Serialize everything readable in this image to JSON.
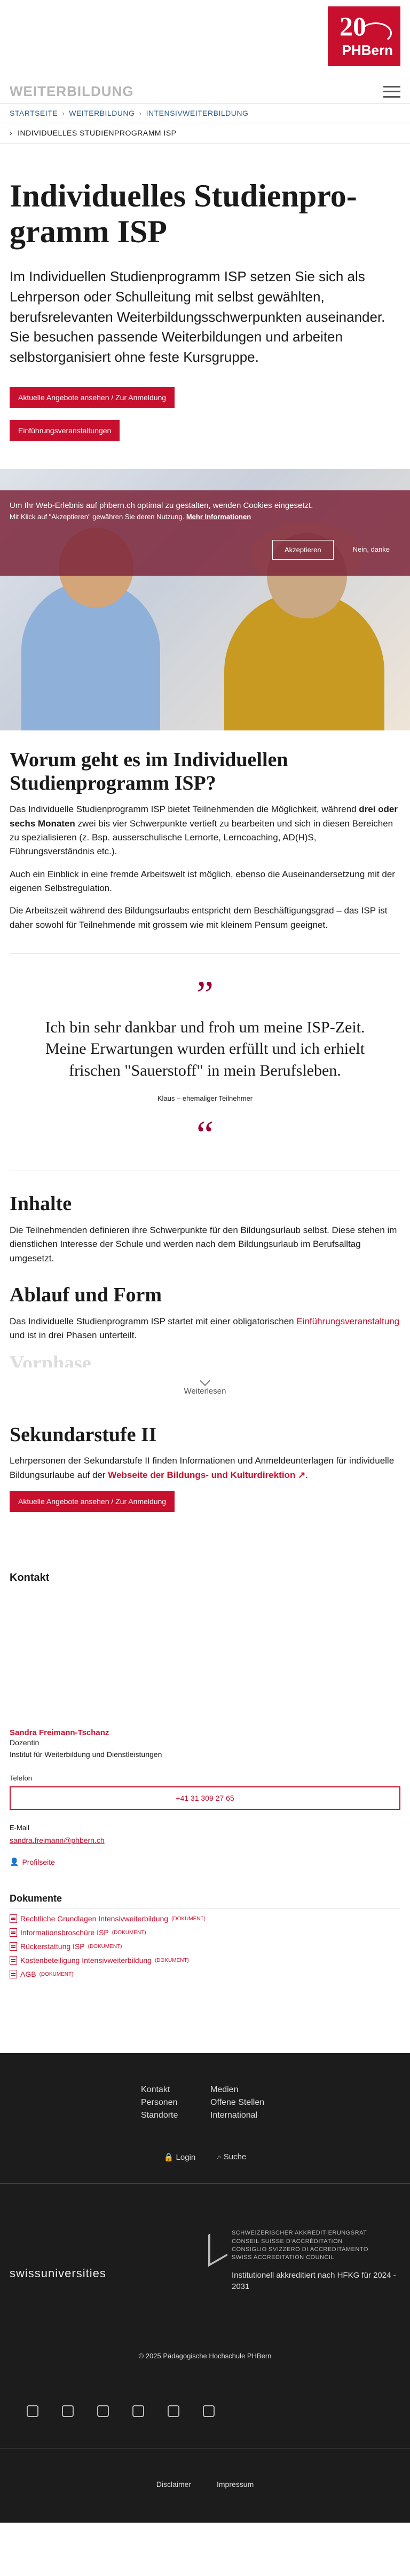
{
  "logo": {
    "number": "20",
    "text": "PHBern"
  },
  "subnav": {
    "title": "WEITERBILDUNG"
  },
  "breadcrumb": [
    "STARTSEITE",
    "WEITERBILDUNG",
    "INTENSIVWEITERBILDUNG"
  ],
  "current_page": "INDIVIDUELLES STUDIENPROGRAMM ISP",
  "title": "Individuelles Studienpro- gramm ISP",
  "lead": "Im Individuellen Studienprogramm ISP setzen Sie sich als Lehrperson oder Schulleitung mit selbst gewählten, berufsrelevanten Weiterbildungsschwerpunkten auseinander. Sie besuchen passende Weiterbildungen und arbeiten selbstorganisiert ohne feste Kursgruppe.",
  "buttons": {
    "offers": "Aktuelle Angebote ansehen / Zur Anmeldung",
    "events": "Einführungsveranstaltungen"
  },
  "cookie": {
    "text": "Um Ihr Web-Erlebnis auf phbern.ch optimal zu gestalten, wenden Cookies eingesetzt.",
    "small": "Mit Klick auf \"Akzeptieren\" gewähren Sie deren Nutzung.",
    "link": "Mehr Informationen",
    "accept": "Akzeptieren",
    "decline": "Nein, danke"
  },
  "section1": {
    "title": "Worum geht es im Individuellen Studienprogramm ISP?",
    "p1a": "Das Individuelle Studienprogramm ISP bietet Teilnehmenden die Möglichkeit, während ",
    "p1b": "drei oder sechs Monaten",
    "p1c": " zwei bis vier Schwerpunkte vertieft zu bearbeiten und sich in diesen Bereichen zu spezialisieren (z. Bsp. ausserschulische Lernorte, Lerncoaching, AD(H)S, Führungsverständnis etc.).",
    "p2": "Auch ein Einblick in eine fremde Arbeitswelt ist möglich, ebenso die Auseinandersetzung mit der eigenen Selbstregulation.",
    "p3": "Die Arbeitszeit während des Bildungsurlaubs entspricht dem Beschäftigungsgrad – das ISP ist daher sowohl für Teilnehmende mit grossem wie mit kleinem Pensum geeignet."
  },
  "quote": {
    "text": "Ich bin sehr dankbar und froh um meine ISP-Zeit. Meine Erwartungen wurden erfüllt und ich erhielt frischen \"Sauerstoff\" in mein Berufsleben.",
    "author": "Klaus – ehemaliger Teilnehmer"
  },
  "inhalte": {
    "title": "Inhalte",
    "text": "Die Teilnehmenden definieren ihre Schwerpunkte für den Bildungsurlaub selbst. Diese stehen im dienstlichen Interesse der Schule und werden nach dem Bildungsurlaub im Berufsalltag umgesetzt."
  },
  "ablauf": {
    "title": "Ablauf und Form",
    "text_a": "Das Individuelle Studienprogramm ISP startet mit einer obligatorischen ",
    "link": "Einführungsveranstaltung",
    "text_b": " und ist in drei Phasen unterteilt.",
    "ghost": "Vorphase",
    "read_more": "Weiterlesen"
  },
  "sek2": {
    "title": "Sekundarstufe II",
    "text_a": "Lehrpersonen der Sekundarstufe II finden Informationen und Anmeldeunterlagen für individuelle Bildungsurlaube auf der ",
    "link": "Webseite der Bildungs- und Kulturdirektion ↗",
    "text_b": ".",
    "button": "Aktuelle Angebote ansehen / Zur Anmeldung"
  },
  "contact": {
    "heading": "Kontakt",
    "name": "Sandra Freimann-Tschanz",
    "role": "Dozentin",
    "institute": "Institut für Weiterbildung und Dienstleistungen",
    "phone_label": "Telefon",
    "phone": "+41 31 309 27 65",
    "email_label": "E-Mail",
    "email": "sandra.freimann@phbern.ch",
    "profile": "Profilseite"
  },
  "documents": {
    "title": "Dokumente",
    "items": [
      {
        "name": "Rechtliche Grundlagen Intensivweiterbildung",
        "tag": "(DOKUMENT)"
      },
      {
        "name": "Informationsbroschüre ISP",
        "tag": "(DOKUMENT)"
      },
      {
        "name": "Rückerstattung ISP",
        "tag": "(DOKUMENT)"
      },
      {
        "name": "Kostenbeteiligung Intensivweiterbildung",
        "tag": "(DOKUMENT)"
      },
      {
        "name": "AGB",
        "tag": "(DOKUMENT)"
      }
    ]
  },
  "footer": {
    "nav": [
      "Kontakt",
      "Medien",
      "Personen",
      "Offene Stellen",
      "Standorte",
      "International"
    ],
    "login": "Login",
    "search": "Suche",
    "swissuniversities": "swissuniversities",
    "accreditation_lines": [
      "SCHWEIZERISCHER AKKREDITIERUNGSRAT",
      "CONSEIL SUISSE D'ACCRÉDITATION",
      "CONSIGLIO SVIZZERO DI ACCREDITAMENTO",
      "SWISS ACCREDITATION COUNCIL"
    ],
    "accreditation_note": "Institutionell akkreditiert nach HFKG für 2024 - 2031",
    "copyright": "© 2025 Pädagogische Hochschule PHBern",
    "socials": [
      "facebook-icon",
      "instagram-icon",
      "youtube-icon",
      "linkedin-icon",
      "x-icon",
      "google-icon"
    ],
    "legal": [
      "Disclaimer",
      "Impressum"
    ]
  },
  "colors": {
    "brand": "#c8102e",
    "cookie_bg": "#7d243a",
    "footer_bg": "#1c1c1c"
  }
}
